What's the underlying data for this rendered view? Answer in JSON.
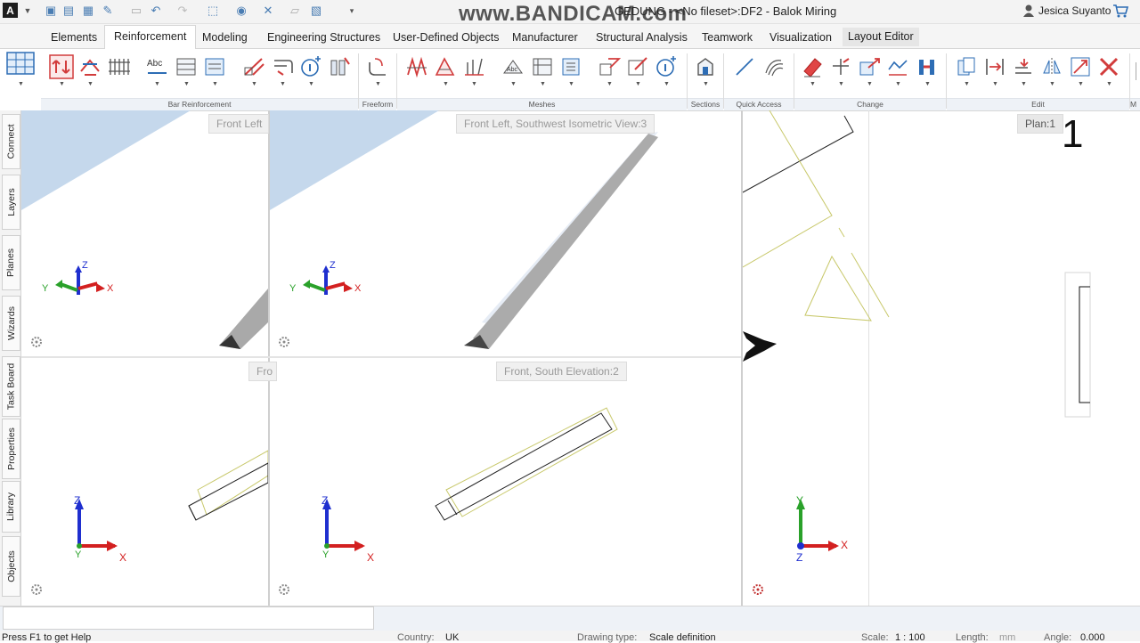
{
  "window": {
    "title": "GEDUNG - <No fileset>:DF2 - Balok Miring",
    "app_logo": "A",
    "watermark": "www.BANDICAM.com",
    "user": "Jesica Suyanto"
  },
  "tabs": [
    {
      "label": "Elements"
    },
    {
      "label": "Reinforcement"
    },
    {
      "label": "Modeling"
    },
    {
      "label": "Engineering Structures"
    },
    {
      "label": "User-Defined Objects"
    },
    {
      "label": "Manufacturer"
    },
    {
      "label": "Structural Analysis"
    },
    {
      "label": "Teamwork"
    },
    {
      "label": "Visualization"
    },
    {
      "label": "Layout Editor"
    }
  ],
  "ribbon_groups": [
    {
      "label": "Bar Reinforcement"
    },
    {
      "label": "Freeform"
    },
    {
      "label": "Meshes"
    },
    {
      "label": "Sections"
    },
    {
      "label": "Quick Access"
    },
    {
      "label": "Change"
    },
    {
      "label": "Edit"
    },
    {
      "label": "M"
    }
  ],
  "side_tabs": [
    {
      "label": "Connect"
    },
    {
      "label": "Layers"
    },
    {
      "label": "Planes"
    },
    {
      "label": "Wizards"
    },
    {
      "label": "Task Board"
    },
    {
      "label": "Properties"
    },
    {
      "label": "Library"
    },
    {
      "label": "Objects"
    }
  ],
  "views": {
    "top_left_label": "Front Left",
    "top_right_label": "Front Left, Southwest Isometric View:3",
    "bottom_left_label": "Fro",
    "bottom_right_label": "Front, South Elevation:2",
    "plan_label": "Plan:1",
    "plan_number": "1"
  },
  "axes": {
    "x": "X",
    "y": "Y",
    "z": "Z"
  },
  "status": {
    "help": "Press F1 to get Help",
    "country_label": "Country:",
    "country": "UK",
    "drawing_type_label": "Drawing type:",
    "drawing_type": "Scale definition",
    "scale_label": "Scale:",
    "scale": "1 : 100",
    "length_label": "Length:",
    "length_unit": "mm",
    "angle_label": "Angle:",
    "angle": "0.000"
  },
  "colors": {
    "accent": "#2d6db5",
    "slab": "#c5d8ec",
    "beam": "#b0b0b0",
    "outline_yellow": "#c8c86a",
    "axis_x": "#d32020",
    "axis_y": "#2aa12a",
    "axis_z": "#1f2fcf",
    "ribbon_red": "#d23c3c"
  }
}
